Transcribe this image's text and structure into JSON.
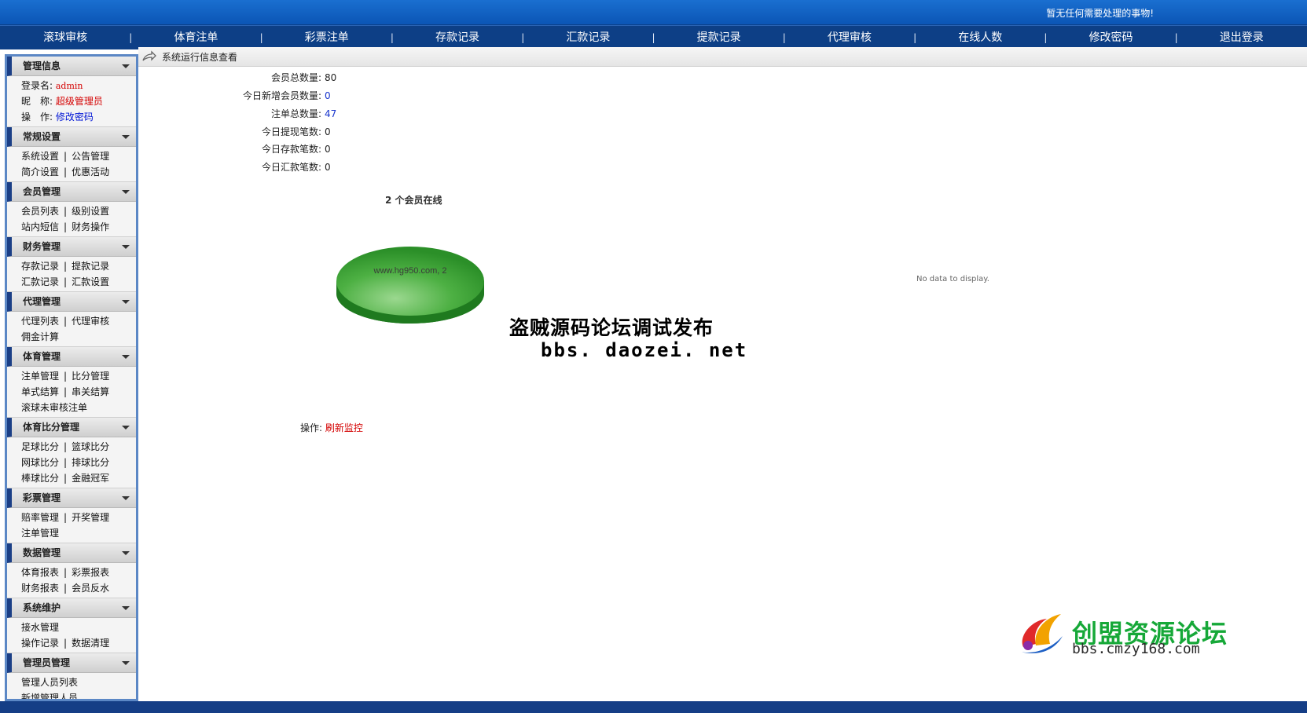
{
  "header": {
    "notice": "暂无任何需要处理的事物!"
  },
  "nav": {
    "items": [
      "滚球审核",
      "体育注单",
      "彩票注单",
      "存款记录",
      "汇款记录",
      "提款记录",
      "代理审核",
      "在线人数",
      "修改密码",
      "退出登录"
    ]
  },
  "sidebar": {
    "admin_info": {
      "title": "管理信息",
      "login_label": "登录名:",
      "login_value": "admin",
      "nick_label": "昵　称:",
      "nick_value": "超级管理员",
      "op_label": "操　作:",
      "op_value": "修改密码"
    },
    "sections": [
      {
        "title": "常规设置",
        "rows": [
          [
            "系统设置",
            "公告管理"
          ],
          [
            "简介设置",
            "优惠活动"
          ]
        ]
      },
      {
        "title": "会员管理",
        "rows": [
          [
            "会员列表",
            "级别设置"
          ],
          [
            "站内短信",
            "财务操作"
          ]
        ]
      },
      {
        "title": "财务管理",
        "rows": [
          [
            "存款记录",
            "提款记录"
          ],
          [
            "汇款记录",
            "汇款设置"
          ]
        ]
      },
      {
        "title": "代理管理",
        "rows": [
          [
            "代理列表",
            "代理审核"
          ],
          [
            "佣金计算"
          ]
        ]
      },
      {
        "title": "体育管理",
        "rows": [
          [
            "注单管理",
            "比分管理"
          ],
          [
            "单式结算",
            "串关结算"
          ],
          [
            "滚球未审核注单"
          ]
        ]
      },
      {
        "title": "体育比分管理",
        "rows": [
          [
            "足球比分",
            "篮球比分"
          ],
          [
            "网球比分",
            "排球比分"
          ],
          [
            "棒球比分",
            "金融冠军"
          ]
        ]
      },
      {
        "title": "彩票管理",
        "rows": [
          [
            "赔率管理",
            "开奖管理"
          ],
          [
            "注单管理"
          ]
        ]
      },
      {
        "title": "数据管理",
        "rows": [
          [
            "体育报表",
            "彩票报表"
          ],
          [
            "财务报表",
            "会员反水"
          ]
        ]
      },
      {
        "title": "系统维护",
        "rows": [
          [
            "接水管理"
          ],
          [
            "操作记录",
            "数据清理"
          ]
        ]
      },
      {
        "title": "管理员管理",
        "rows": [
          [
            "管理人员列表"
          ],
          [
            "新增管理人员"
          ]
        ]
      }
    ]
  },
  "breadcrumb": {
    "text": "系统运行信息查看"
  },
  "stats": [
    {
      "label": "会员总数量:",
      "value": "80",
      "color": "#222222"
    },
    {
      "label": "今日新增会员数量:",
      "value": "0",
      "color": "#1633cc"
    },
    {
      "label": "注单总数量:",
      "value": "47",
      "color": "#1633cc"
    },
    {
      "label": "今日提现笔数:",
      "value": "0",
      "color": "#222222"
    },
    {
      "label": "今日存款笔数:",
      "value": "0",
      "color": "#222222"
    },
    {
      "label": "今日汇款笔数:",
      "value": "0",
      "color": "#222222"
    }
  ],
  "online": {
    "title": "2 个会员在线",
    "pie_label": "www.hg950.com, 2",
    "pie_value": 2,
    "pie_color": "#2e9a2e",
    "no_data": "No data to display."
  },
  "watermark": {
    "line1": "盗贼源码论坛调试发布",
    "line2": "bbs. daozei. net"
  },
  "operation": {
    "label": "操作:",
    "action": "刷新监控"
  },
  "logo": {
    "line1": "创盟资源论坛",
    "line2": "bbs.cmzy168.com"
  },
  "colors": {
    "nav_bg": "#0d3f86",
    "top_bg": "#0b55b5",
    "sidebar_border": "#5b87c5",
    "accent_red": "#d40000"
  }
}
